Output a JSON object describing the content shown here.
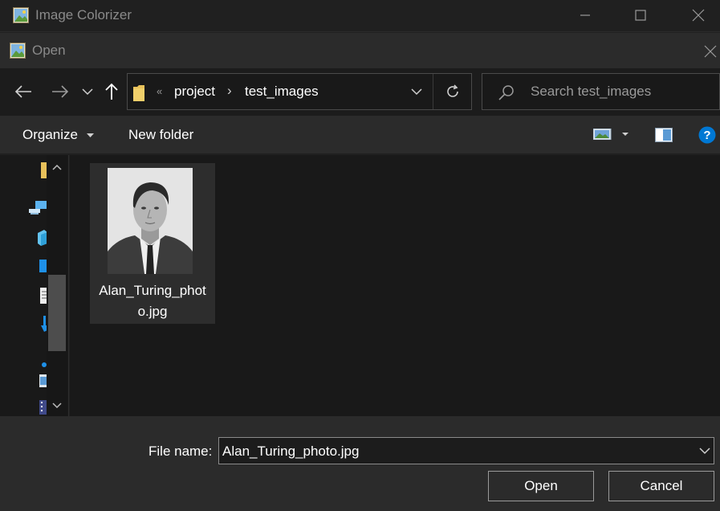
{
  "app": {
    "title": "Image Colorizer",
    "window_controls": [
      "minimize-icon",
      "maximize-icon",
      "close-icon"
    ]
  },
  "dialog": {
    "title": "Open",
    "close_icon": "close-icon"
  },
  "nav": {
    "icons": [
      "back-arrow-icon",
      "forward-arrow-icon",
      "recent-locations-chevron-icon",
      "up-arrow-icon"
    ],
    "address": {
      "separator": "«",
      "breadcrumbs": [
        "project",
        "test_images"
      ],
      "crumb_separator": "›",
      "dropdown_icon": "chevron-down-icon",
      "refresh_icon": "refresh-icon"
    },
    "search": {
      "placeholder": "Search test_images",
      "value": ""
    }
  },
  "toolbar": {
    "organize_label": "Organize",
    "new_folder_label": "New folder",
    "icons": [
      "view-options-icon",
      "preview-pane-icon",
      "help-icon"
    ]
  },
  "navigation_pane": {
    "icons": [
      "folder-icon",
      "network-pc-icon",
      "3d-objects-icon",
      "desktop-icon",
      "documents-icon",
      "downloads-icon",
      "music-icon",
      "pictures-icon",
      "videos-icon"
    ]
  },
  "files": [
    {
      "name": "Alan_Turing_photo.jpg",
      "name_display": [
        "Alan_Turing_phot",
        "o.jpg"
      ],
      "selected": true
    }
  ],
  "footer": {
    "file_name_label": "File name:",
    "file_name_value": "Alan_Turing_photo.jpg",
    "open_label": "Open",
    "cancel_label": "Cancel"
  },
  "colors": {
    "background": "#202020",
    "pane": "#191919",
    "toolbar": "#2b2b2b",
    "accent_blue": "#0078d4",
    "folder_yellow": "#e8c15a"
  }
}
